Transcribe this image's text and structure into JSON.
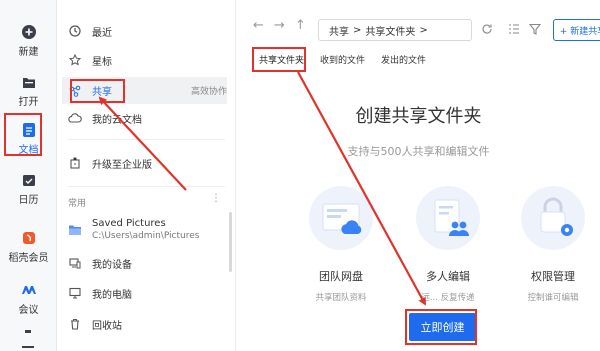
{
  "rail": {
    "items": [
      {
        "label": "新建",
        "icon": "plus-circle-icon"
      },
      {
        "label": "打开",
        "icon": "folder-icon"
      },
      {
        "label": "文档",
        "icon": "document-icon"
      },
      {
        "label": "日历",
        "icon": "calendar-icon"
      },
      {
        "label": "稻壳会员",
        "icon": "docer-icon"
      },
      {
        "label": "会议",
        "icon": "meeting-icon"
      }
    ]
  },
  "sidebar": {
    "items": [
      {
        "label": "最近",
        "icon": "clock-icon"
      },
      {
        "label": "星标",
        "icon": "star-icon"
      },
      {
        "label": "共享",
        "icon": "share-icon",
        "right": "高效协作"
      },
      {
        "label": "我的云文档",
        "icon": "cloud-icon"
      },
      {
        "label": "升级至企业版",
        "icon": "enterprise-icon"
      }
    ],
    "section_label": "常用",
    "section_more": "⋮",
    "common": [
      {
        "label": "Saved Pictures",
        "sub": "C:\\Users\\admin\\Pictures",
        "icon": "folder-icon"
      },
      {
        "label": "我的设备",
        "icon": "device-icon"
      },
      {
        "label": "我的电脑",
        "icon": "computer-icon"
      },
      {
        "label": "回收站",
        "icon": "trash-icon"
      }
    ]
  },
  "toolbar": {
    "crumbs": [
      "共享",
      ">",
      "共享文件夹",
      ">"
    ],
    "new_label": "+ 新建共享"
  },
  "tabs": [
    "共享文件夹",
    "收到的文件",
    "发出的文件"
  ],
  "hero": {
    "title": "创建共享文件夹",
    "subtitle": "支持与500人共享和编辑文件"
  },
  "features": [
    {
      "name": "团队网盘",
      "desc": "共享团队资料"
    },
    {
      "name": "多人编辑",
      "desc": "远... 反复传递"
    },
    {
      "name": "权限管理",
      "desc": "控制谁可编辑"
    }
  ],
  "cta": {
    "label": "立即创建"
  },
  "colors": {
    "accent": "#1f6bf0",
    "annotation": "#e0332b"
  }
}
